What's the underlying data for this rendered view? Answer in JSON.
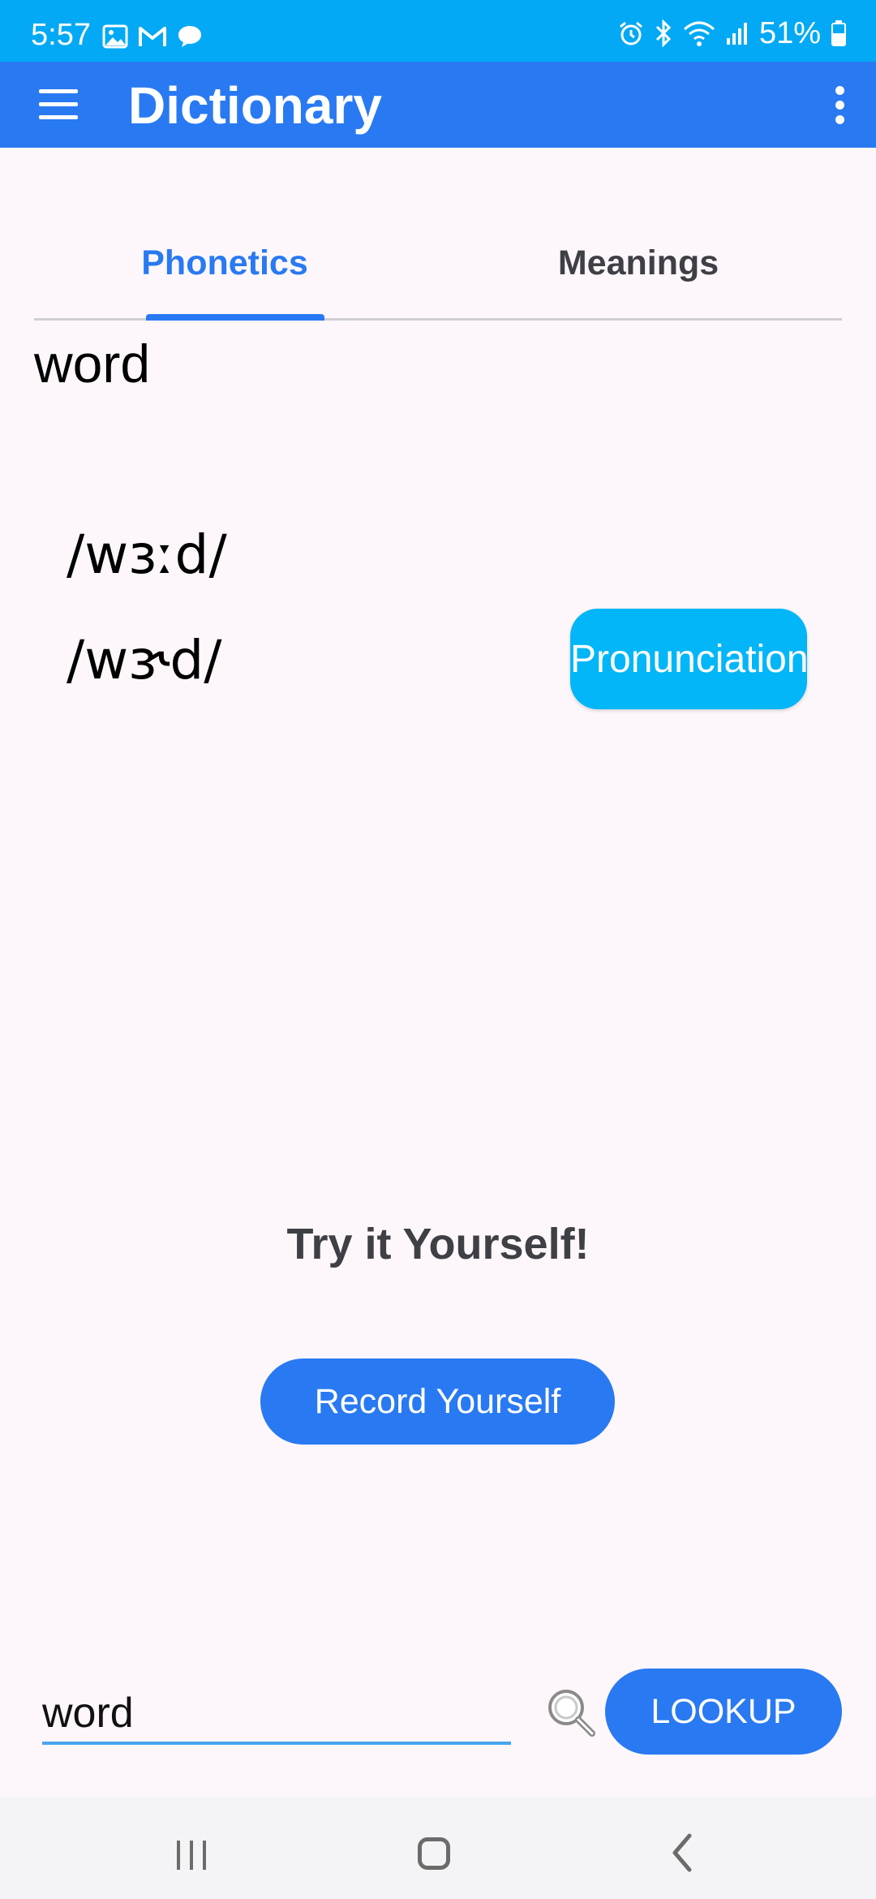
{
  "status_bar": {
    "time": "5:57",
    "battery": "51%",
    "left_icons": [
      "gallery-icon",
      "gmail-icon",
      "chat-icon"
    ],
    "right_icons": [
      "alarm-icon",
      "bluetooth-icon",
      "wifi-icon",
      "signal-icon",
      "battery-icon"
    ]
  },
  "app_bar": {
    "title": "Dictionary",
    "menu_icon": "hamburger-menu-icon",
    "overflow_icon": "more-vert-icon"
  },
  "tabs": [
    {
      "label": "Phonetics",
      "selected": true
    },
    {
      "label": "Meanings",
      "selected": false
    }
  ],
  "word": "word",
  "phonetics": [
    "/wɜːd/",
    "/wɝd/"
  ],
  "pronunciation_button": "Pronunciation",
  "try_heading": "Try it Yourself!",
  "record_button": "Record Yourself",
  "search": {
    "value": "word",
    "lookup_button": "LOOKUP",
    "icon": "magnifier-icon"
  },
  "nav_bar": {
    "icons": [
      "recent-apps-icon",
      "home-icon",
      "back-icon"
    ]
  },
  "colors": {
    "status_bar": "#03a9f4",
    "app_bar": "#2979f2",
    "accent": "#2979f2",
    "pronunciation_button": "#03b6f7",
    "background": "#fdf7fb"
  }
}
